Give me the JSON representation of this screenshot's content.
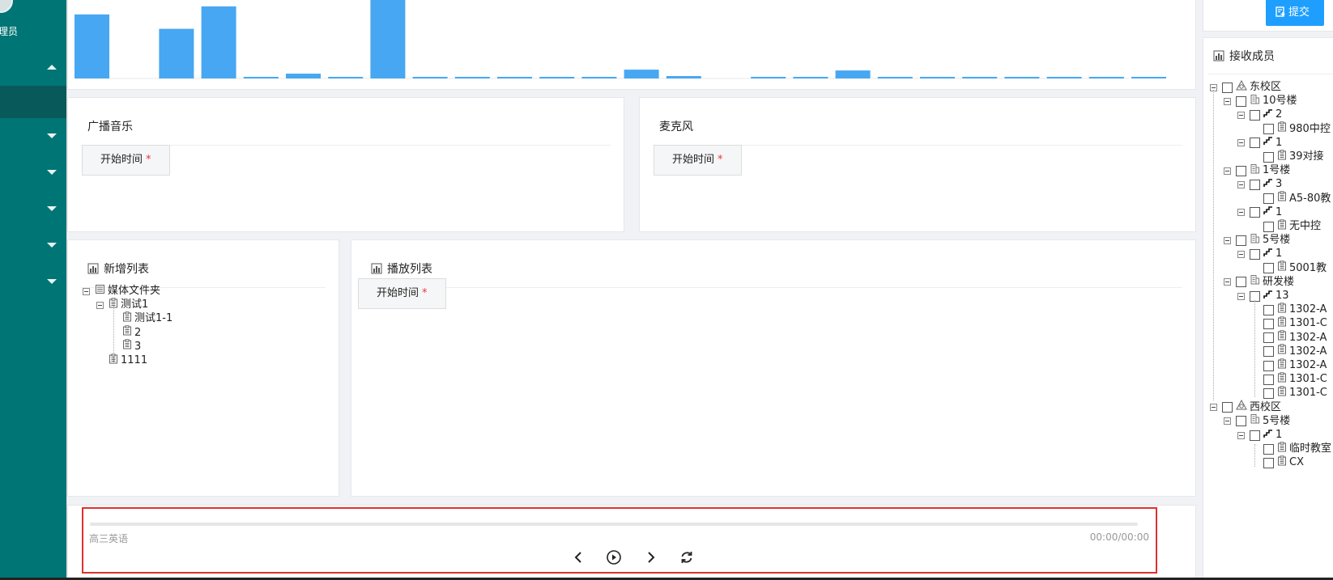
{
  "sidebar": {
    "user_role": "管理员",
    "menu_items": [
      {
        "expanded": true
      },
      {
        "active": true
      },
      {
        "expanded": false
      },
      {
        "expanded": false
      },
      {
        "expanded": false
      },
      {
        "expanded": false
      },
      {
        "expanded": false
      }
    ]
  },
  "chart_data": {
    "type": "bar",
    "title": "",
    "xlabel": "",
    "ylabel": "",
    "ylim": [
      0,
      100
    ],
    "color": "#47a7f2",
    "values": [
      80,
      0,
      62,
      90,
      2,
      6,
      2,
      100,
      2,
      2,
      2,
      2,
      2,
      11,
      3,
      0,
      2,
      2,
      10,
      2,
      2,
      2,
      2,
      2,
      2,
      2
    ]
  },
  "panels": {
    "broadcast_music": {
      "title": "广播音乐",
      "start_time_label": "开始时间",
      "required_mark": "*"
    },
    "microphone": {
      "title": "麦克风",
      "start_time_label": "开始时间",
      "required_mark": "*"
    },
    "new_list": {
      "title": "新增列表"
    },
    "play_list": {
      "title": "播放列表",
      "start_time_label": "开始时间",
      "required_mark": "*"
    }
  },
  "media_tree": [
    {
      "label": "媒体文件夹",
      "level": 0,
      "type": "folder",
      "expander": true
    },
    {
      "label": "测试1",
      "level": 1,
      "type": "doc",
      "expander": true
    },
    {
      "label": "测试1-1",
      "level": 2,
      "type": "doc",
      "expander": false
    },
    {
      "label": "2",
      "level": 2,
      "type": "doc",
      "expander": false
    },
    {
      "label": "3",
      "level": 2,
      "type": "doc",
      "expander": false
    },
    {
      "label": "1111",
      "level": 1,
      "type": "doc",
      "expander": false
    }
  ],
  "toolbar": {
    "submit_label": "提交"
  },
  "receivers": {
    "title": "接收成员",
    "nodes": [
      {
        "label": "东校区",
        "level": 0,
        "type": "campus"
      },
      {
        "label": "10号楼",
        "level": 1,
        "type": "building"
      },
      {
        "label": "2",
        "level": 2,
        "type": "floor"
      },
      {
        "label": "980中控",
        "level": 3,
        "type": "room"
      },
      {
        "label": "1",
        "level": 2,
        "type": "floor"
      },
      {
        "label": "39对接",
        "level": 3,
        "type": "room"
      },
      {
        "label": "1号楼",
        "level": 1,
        "type": "building"
      },
      {
        "label": "3",
        "level": 2,
        "type": "floor"
      },
      {
        "label": "A5-80教",
        "level": 3,
        "type": "room"
      },
      {
        "label": "1",
        "level": 2,
        "type": "floor"
      },
      {
        "label": "无中控",
        "level": 3,
        "type": "room"
      },
      {
        "label": "5号楼",
        "level": 1,
        "type": "building"
      },
      {
        "label": "1",
        "level": 2,
        "type": "floor"
      },
      {
        "label": "5001教",
        "level": 3,
        "type": "room"
      },
      {
        "label": "研发楼",
        "level": 1,
        "type": "building"
      },
      {
        "label": "13",
        "level": 2,
        "type": "floor"
      },
      {
        "label": "1302-A",
        "level": 3,
        "type": "room"
      },
      {
        "label": "1301-C",
        "level": 3,
        "type": "room"
      },
      {
        "label": "1302-A",
        "level": 3,
        "type": "room"
      },
      {
        "label": "1302-A",
        "level": 3,
        "type": "room"
      },
      {
        "label": "1302-A",
        "level": 3,
        "type": "room"
      },
      {
        "label": "1301-C",
        "level": 3,
        "type": "room"
      },
      {
        "label": "1301-C",
        "level": 3,
        "type": "room"
      },
      {
        "label": "西校区",
        "level": 0,
        "type": "campus"
      },
      {
        "label": "5号楼",
        "level": 1,
        "type": "building"
      },
      {
        "label": "1",
        "level": 2,
        "type": "floor"
      },
      {
        "label": "临时教室",
        "level": 3,
        "type": "room"
      },
      {
        "label": "CX",
        "level": 3,
        "type": "room"
      }
    ]
  },
  "player": {
    "track_name": "高三英语",
    "time": "00:00/00:00",
    "progress": 0,
    "controls": [
      "chevron-left-icon",
      "play-circle-icon",
      "chevron-right-icon",
      "refresh-icon"
    ]
  }
}
